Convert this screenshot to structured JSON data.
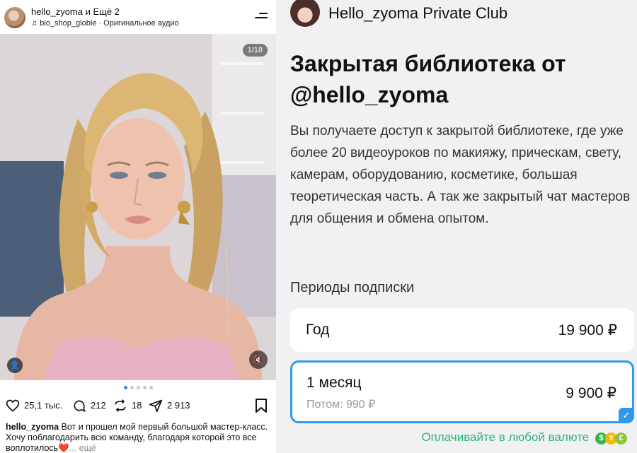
{
  "post": {
    "author": "hello_zyoma и Ещё 2",
    "audio": "bio_shop_globle · Оригинальное аудио",
    "slide_counter": "1/18",
    "likes": "25,1 тыс.",
    "comments": "212",
    "reposts": "18",
    "shares": "2 913",
    "caption_user": "hello_zyoma",
    "caption_text": " Вот и прошел мой первый большой мастер-класс. Хочу поблагодарить всю команду, благодаря которой это все воплотилось",
    "caption_emoji": "❤️",
    "caption_more": "... ещё"
  },
  "club": {
    "name": "Hello_zyoma Private Club",
    "title": "Закрытая библиотека от @hello_zyoma",
    "description": "Вы получаете доступ к закрытой библиотеке, где уже более 20 видеоуроков по макияжу, прическам, свету, камерам, оборудованию, косметике, большая теоретическая часть. А так же закрытый чат мастеров для общения и обмена опытом.",
    "periods_label": "Периоды подписки",
    "plans": [
      {
        "label": "Год",
        "price": "19 900 ₽"
      },
      {
        "label": "1 месяц",
        "price": "9 900 ₽",
        "sub": "Потом: 990 ₽"
      }
    ],
    "pay_note": "Оплачивайте в любой валюте",
    "currency_icons": [
      "$",
      "¥",
      "£"
    ]
  },
  "colors": {
    "accent_blue": "#2f9be8",
    "pay_green": "#2bb673"
  }
}
